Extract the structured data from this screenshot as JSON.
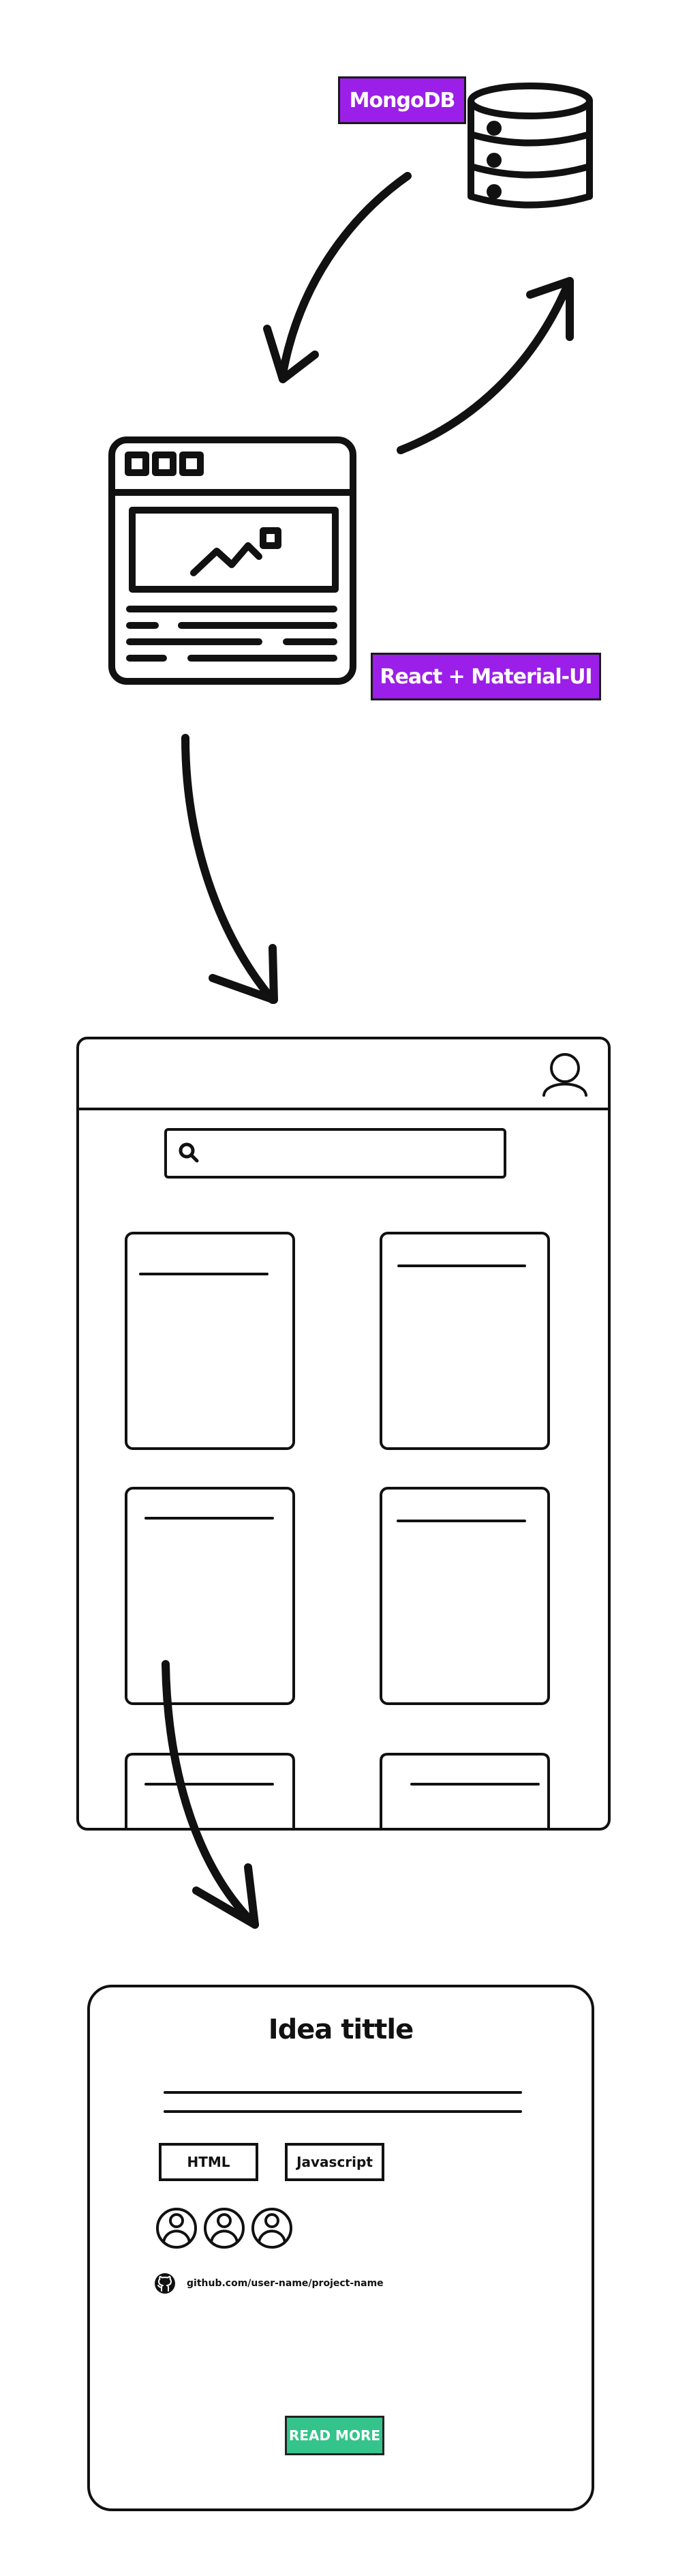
{
  "labels": {
    "database": "MongoDB",
    "frontend": "React + Material-UI"
  },
  "card": {
    "title": "Idea tittle",
    "tags": [
      "HTML",
      "Javascript"
    ],
    "repo_link": "github.com/user-name/project-name",
    "button_label": "READ MORE",
    "member_count": 3
  },
  "colors": {
    "label_fill": "#9b1fe8",
    "button_fill": "#34c48b",
    "stroke": "#111111"
  },
  "icons": [
    "database-icon",
    "browser-window-icon",
    "user-icon",
    "search-icon",
    "github-icon"
  ]
}
